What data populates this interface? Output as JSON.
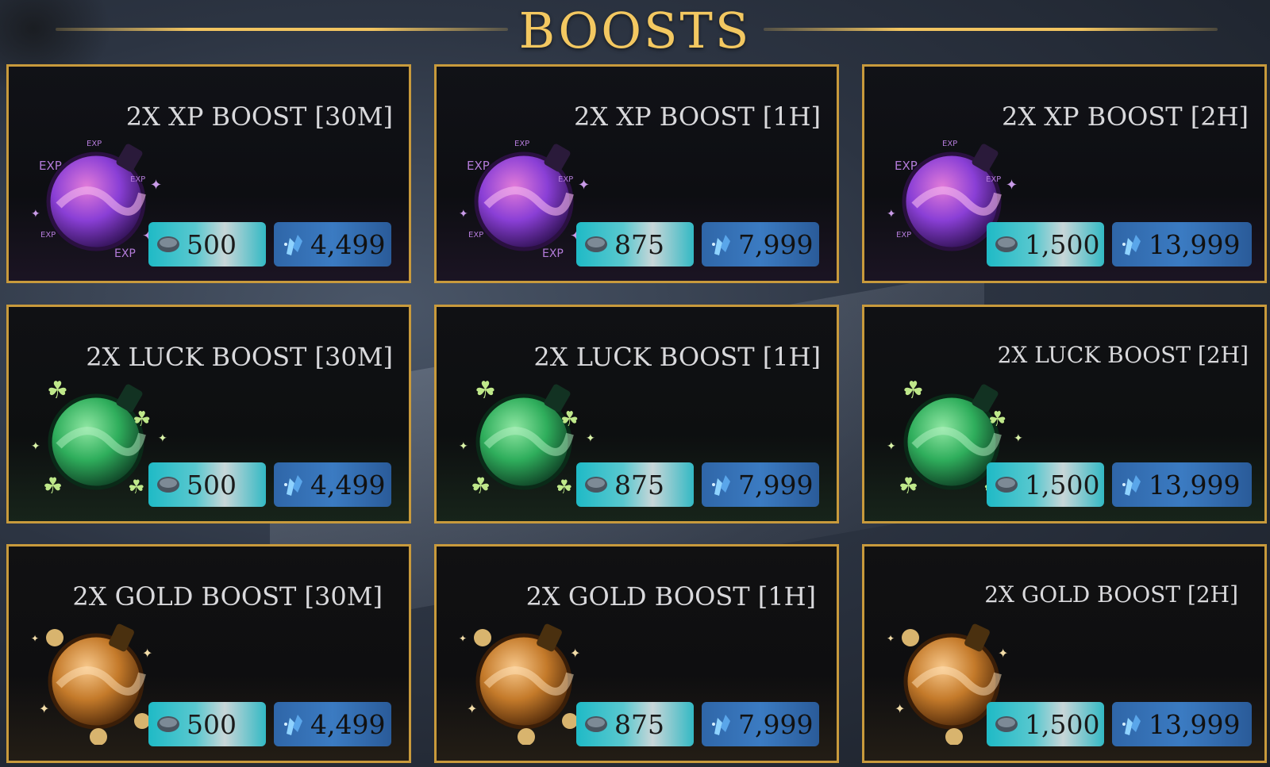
{
  "header": {
    "title": "BOOSTS"
  },
  "colors": {
    "accent": "#f3c861",
    "border": "#c89a3c",
    "xp": "#8a3fd6",
    "luck": "#2fae5c",
    "gold": "#c47a2a"
  },
  "cards": [
    {
      "title": "2X XP BOOST [30M]",
      "coins": "500",
      "gems": "4,499",
      "icon": "xp-potion-icon"
    },
    {
      "title": "2X XP BOOST [1H]",
      "coins": "875",
      "gems": "7,999",
      "icon": "xp-potion-icon"
    },
    {
      "title": "2X XP BOOST [2H]",
      "coins": "1,500",
      "gems": "13,999",
      "icon": "xp-potion-icon"
    },
    {
      "title": "2X LUCK BOOST [30M]",
      "coins": "500",
      "gems": "4,499",
      "icon": "luck-potion-icon"
    },
    {
      "title": "2X LUCK BOOST [1H]",
      "coins": "875",
      "gems": "7,999",
      "icon": "luck-potion-icon"
    },
    {
      "title": "2X LUCK BOOST [2H]",
      "coins": "1,500",
      "gems": "13,999",
      "icon": "luck-potion-icon"
    },
    {
      "title": "2X GOLD BOOST [30M]",
      "coins": "500",
      "gems": "4,499",
      "icon": "gold-potion-icon"
    },
    {
      "title": "2X GOLD BOOST [1H]",
      "coins": "875",
      "gems": "7,999",
      "icon": "gold-potion-icon"
    },
    {
      "title": "2X GOLD BOOST [2H]",
      "coins": "1,500",
      "gems": "13,999",
      "icon": "gold-potion-icon"
    }
  ]
}
